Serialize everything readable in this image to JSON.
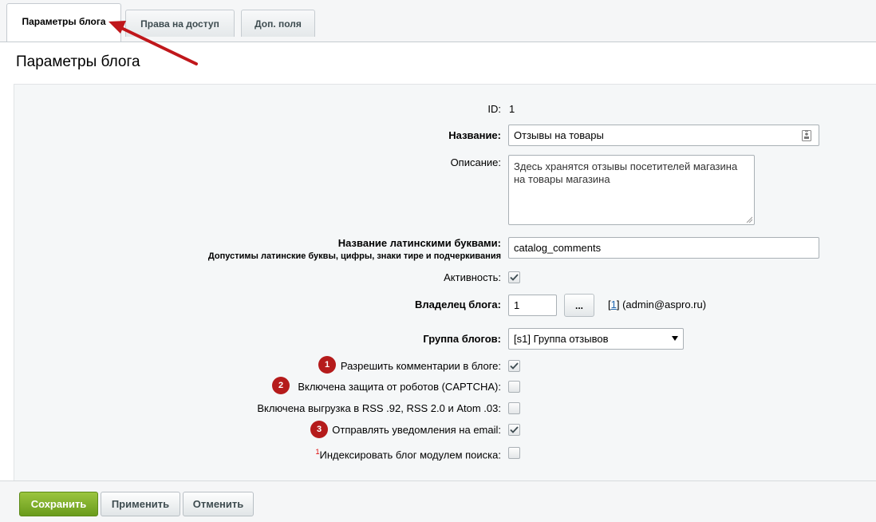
{
  "tabs": [
    {
      "label": "Параметры блога",
      "active": true
    },
    {
      "label": "Права на доступ",
      "active": false
    },
    {
      "label": "Доп. поля",
      "active": false
    }
  ],
  "panel_title": "Параметры блога",
  "form": {
    "id_label": "ID:",
    "id_value": "1",
    "name_label": "Название:",
    "name_value": "Отзывы на товары",
    "description_label": "Описание:",
    "description_value": "Здесь хранятся отзывы посетителей магазина на товары магазина",
    "latin_name_label": "Название латинскими буквами:",
    "latin_name_hint": "Допустимы латинские буквы, цифры, знаки тире и подчеркивания",
    "latin_name_value": "catalog_comments",
    "active_label": "Активность:",
    "active_checked": true,
    "owner_label": "Владелец блога:",
    "owner_value": "1",
    "owner_button": "...",
    "owner_link": "1",
    "owner_email": "(admin@aspro.ru)",
    "group_label": "Группа блогов:",
    "group_value": "[s1] Группа отзывов",
    "options": [
      {
        "label": "Разрешить комментарии в блоге:",
        "checked": true,
        "badge": "1"
      },
      {
        "label": "Включена защита от роботов (CAPTCHA):",
        "checked": false,
        "badge": "2"
      },
      {
        "label": "Включена выгрузка в RSS .92, RSS 2.0 и Atom .03:",
        "checked": false,
        "badge": ""
      },
      {
        "label": "Отправлять уведомления на email:",
        "checked": true,
        "badge": "3"
      },
      {
        "label": "Индексировать блог модулем поиска:",
        "checked": false,
        "badge": "",
        "sup": "1"
      }
    ]
  },
  "buttons": {
    "save": "Сохранить",
    "apply": "Применить",
    "cancel": "Отменить"
  },
  "colors": {
    "badge": "#b51b1b",
    "arrow": "#c0171b",
    "save_button": "#7fae2a"
  }
}
